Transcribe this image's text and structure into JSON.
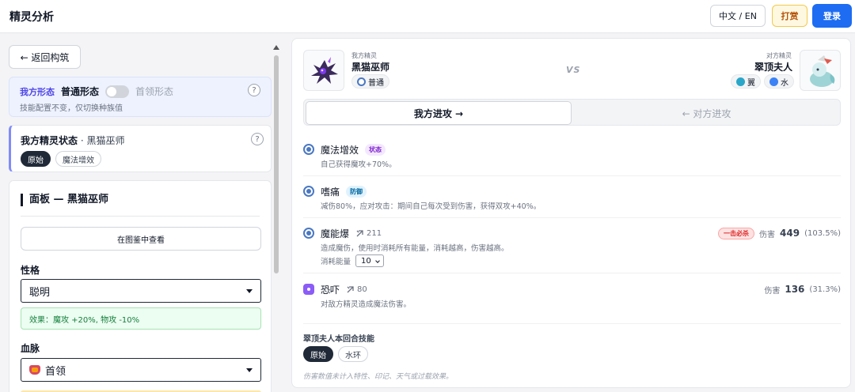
{
  "header": {
    "title": "精灵分析",
    "lang_label": "中文 / EN",
    "tip_label": "打赏",
    "login_label": "登录"
  },
  "sidebar": {
    "back_label": "← 返回构筑",
    "form": {
      "label": "我方形态",
      "current": "普通形态",
      "alternate": "首领形态",
      "note": "技能配置不变，仅切换种族值",
      "help": "?"
    },
    "state": {
      "title": "我方精灵状态",
      "subject": "· 黑猫巫师",
      "help": "?",
      "pills": [
        "原始",
        "魔法增效"
      ]
    },
    "panel": {
      "title": "面板 — 黑猫巫师",
      "codex_label": "在图鉴中查看",
      "nature_label": "性格",
      "nature_value": "聪明",
      "effect": "效果：魔攻 +20%, 物攻 -10%",
      "bloodline_label": "血脉",
      "bloodline_value": "首领"
    }
  },
  "battle": {
    "ally": {
      "side_label": "我方精灵",
      "name": "黑猫巫师",
      "types": [
        {
          "label": "普通",
          "color": "#4a78c2"
        }
      ]
    },
    "vs_label": "VS",
    "enemy": {
      "side_label": "对方精灵",
      "name": "翠顶夫人",
      "types": [
        {
          "label": "翼",
          "color": "#2aa6c9"
        },
        {
          "label": "水",
          "color": "#3b82f6"
        }
      ]
    },
    "tabs": {
      "attack_label": "我方进攻 →",
      "defend_label": "← 对方进攻"
    },
    "skills": [
      {
        "name": "魔法增效",
        "badge": "状态",
        "desc": "自己获得魔攻+70%。"
      },
      {
        "name": "嗜痛",
        "badge": "防御",
        "desc": "减伤80%，应对攻击：期间自己每次受到伤害，获得双攻+40%。"
      },
      {
        "name": "魔能爆",
        "cost": "211",
        "desc": "造成魔伤，使用时消耗所有能量，消耗越高，伤害越高。",
        "energy_label": "消耗能量",
        "energy_value": "10",
        "kill_label": "一击必杀",
        "damage_label": "伤害",
        "damage_value": "449",
        "damage_pct": "(103.5%)"
      },
      {
        "name": "恐吓",
        "cost": "80",
        "desc": "对敌方精灵造成魔法伤害。",
        "damage_label": "伤害",
        "damage_value": "136",
        "damage_pct": "(31.3%)"
      }
    ],
    "opponent_skills": {
      "title": "翠顶夫人本回合技能",
      "pills": [
        "原始",
        "水环"
      ]
    },
    "footnote": "伤害数值未计入特性、印记、天气或过载效果。"
  }
}
